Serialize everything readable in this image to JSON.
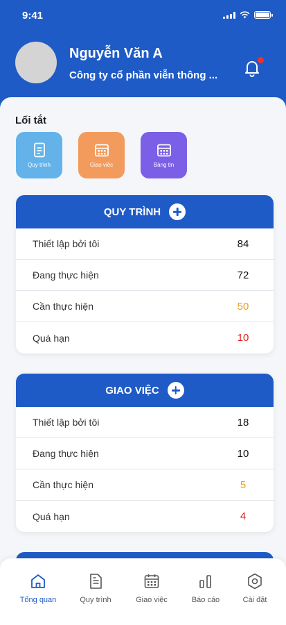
{
  "status": {
    "time": "9:41"
  },
  "profile": {
    "name": "Nguyễn Văn A",
    "company": "Công ty cổ phần viễn thông ..."
  },
  "shortcuts": {
    "title": "Lối tắt",
    "items": [
      {
        "label": "Quy trình",
        "color": "#63b3ea"
      },
      {
        "label": "Giao việc",
        "color": "#f39b5c"
      },
      {
        "label": "Bảng tin",
        "color": "#7b5fe6"
      }
    ]
  },
  "cards": [
    {
      "title": "QUY TRÌNH",
      "rows": [
        {
          "label": "Thiết lập bởi tôi",
          "value": "84"
        },
        {
          "label": "Đang thực hiện",
          "value": "72"
        },
        {
          "label": "Cần thực hiện",
          "value": "50"
        },
        {
          "label": "Quá hạn",
          "value": "10"
        }
      ]
    },
    {
      "title": "GIAO VIỆC",
      "rows": [
        {
          "label": "Thiết lập bởi tôi",
          "value": "18"
        },
        {
          "label": "Đang thực hiện",
          "value": "10"
        },
        {
          "label": "Cần thực hiện",
          "value": "5"
        },
        {
          "label": "Quá hạn",
          "value": "4"
        }
      ]
    }
  ],
  "tabs": [
    {
      "label": "Tổng quan",
      "active": true
    },
    {
      "label": "Quy trình",
      "active": false
    },
    {
      "label": "Giao việc",
      "active": false
    },
    {
      "label": "Báo cáo",
      "active": false
    },
    {
      "label": "Cài đặt",
      "active": false
    }
  ],
  "colors": {
    "primary": "#1f5bc6",
    "warning": "#f29d14",
    "danger": "#e21b1b"
  }
}
